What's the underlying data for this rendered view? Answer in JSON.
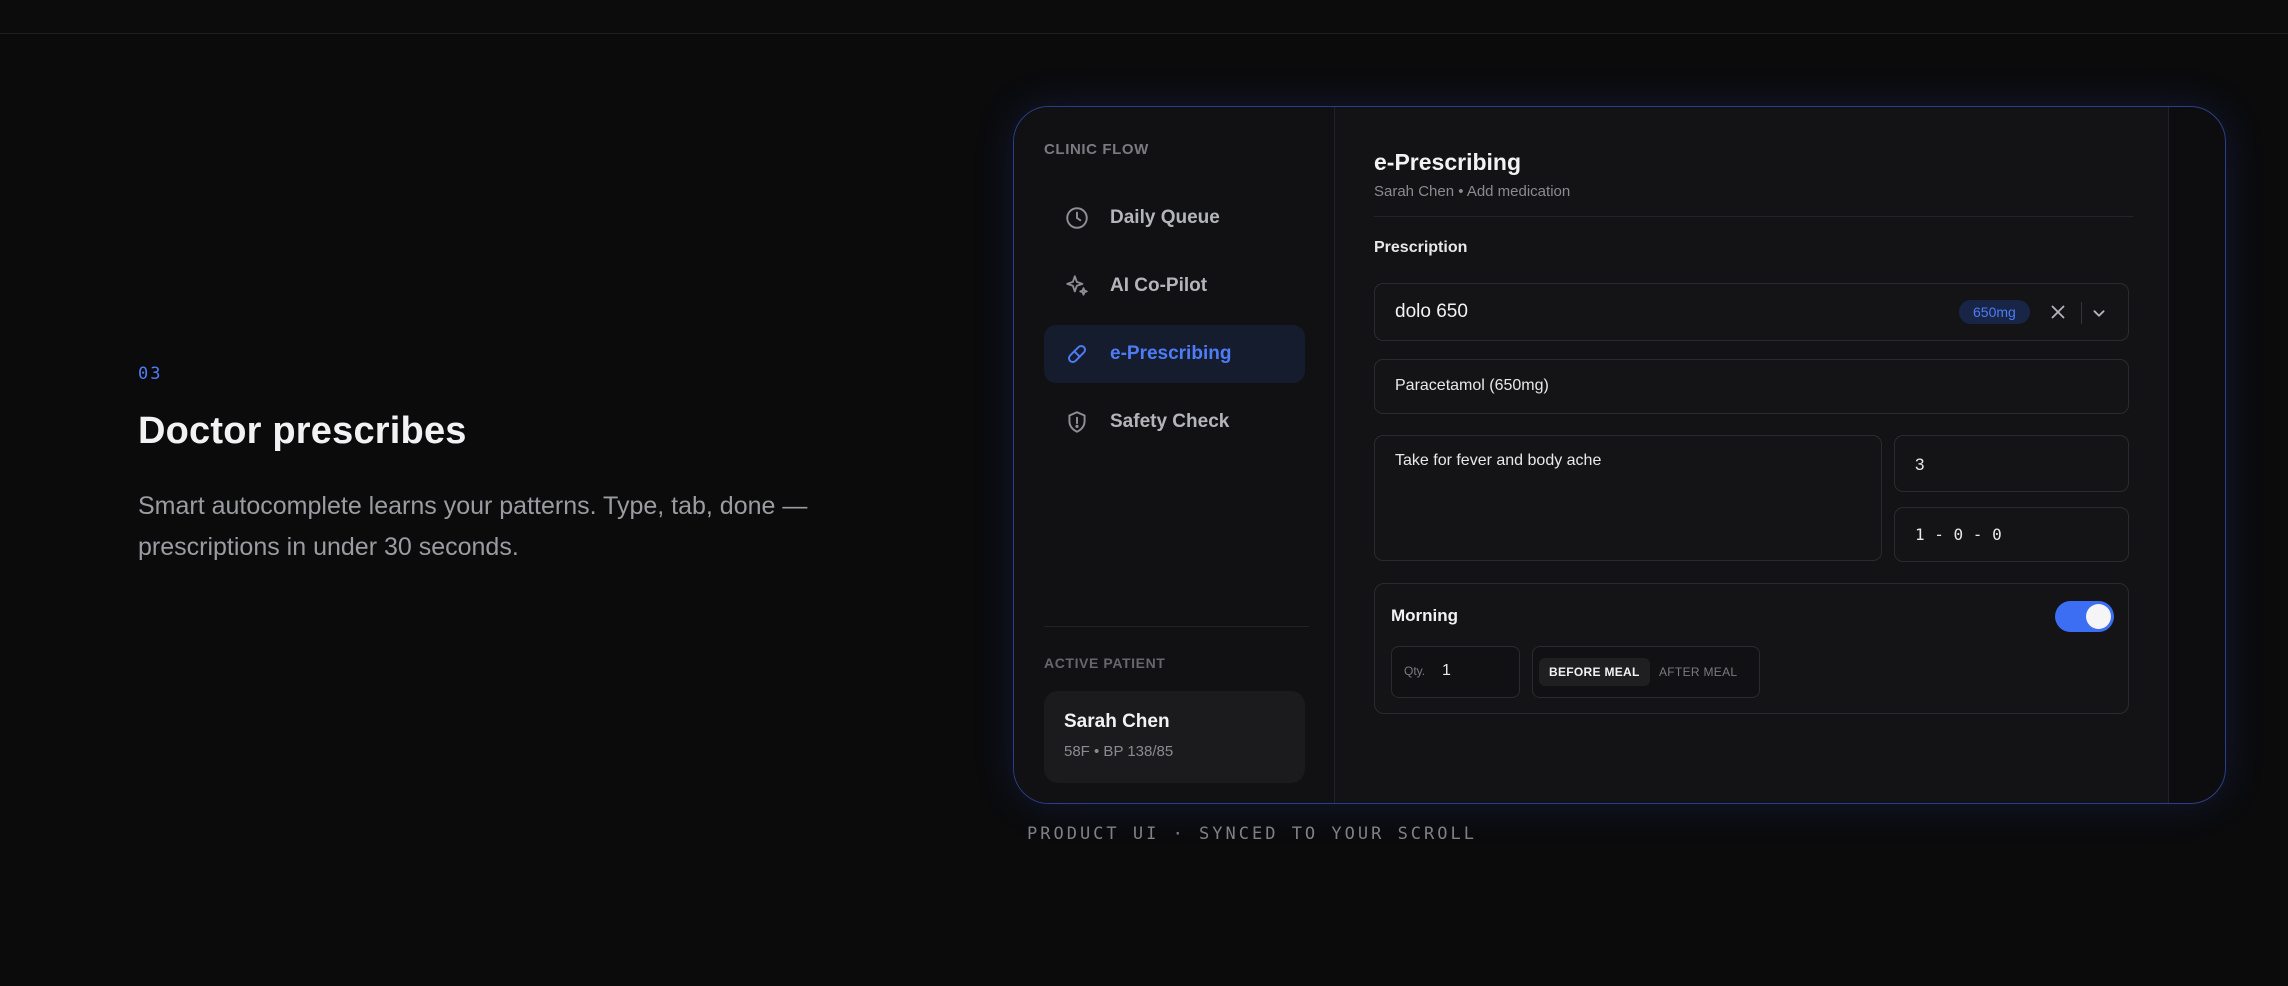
{
  "intro": {
    "step": "03",
    "headline": "Doctor prescribes",
    "description": "Smart autocomplete learns your patterns. Type, tab, done — prescriptions in under 30 seconds."
  },
  "sidebar": {
    "heading": "CLINIC FLOW",
    "items": [
      {
        "label": "Daily Queue",
        "icon": "clock-icon",
        "active": false
      },
      {
        "label": "AI Co-Pilot",
        "icon": "sparkles-icon",
        "active": false
      },
      {
        "label": "e-Prescribing",
        "icon": "pill-icon",
        "active": true
      },
      {
        "label": "Safety Check",
        "icon": "shield-alert-icon",
        "active": false
      }
    ],
    "active_patient_heading": "ACTIVE PATIENT",
    "patient": {
      "name": "Sarah Chen",
      "meta": "58F • BP 138/85"
    }
  },
  "main": {
    "title": "e-Prescribing",
    "subtitle": "Sarah Chen • Add medication",
    "section_label": "Prescription",
    "search_value": "dolo 650",
    "strength_badge": "650mg",
    "generic_name": "Paracetamol (650mg)",
    "notes": "Take for fever and body ache",
    "duration": "3",
    "frequency": "1 - 0 - 0",
    "dose": {
      "label": "Morning",
      "enabled": true,
      "qty_label": "Qty.",
      "qty_value": "1",
      "meal_options": [
        "BEFORE MEAL",
        "AFTER MEAL"
      ],
      "selected_meal": "BEFORE MEAL"
    }
  },
  "caption": "PRODUCT UI · SYNCED TO YOUR SCROLL",
  "colors": {
    "accent": "#4d7cf6",
    "background": "#0b0b0c",
    "toggle_on": "#3b6ef2"
  }
}
